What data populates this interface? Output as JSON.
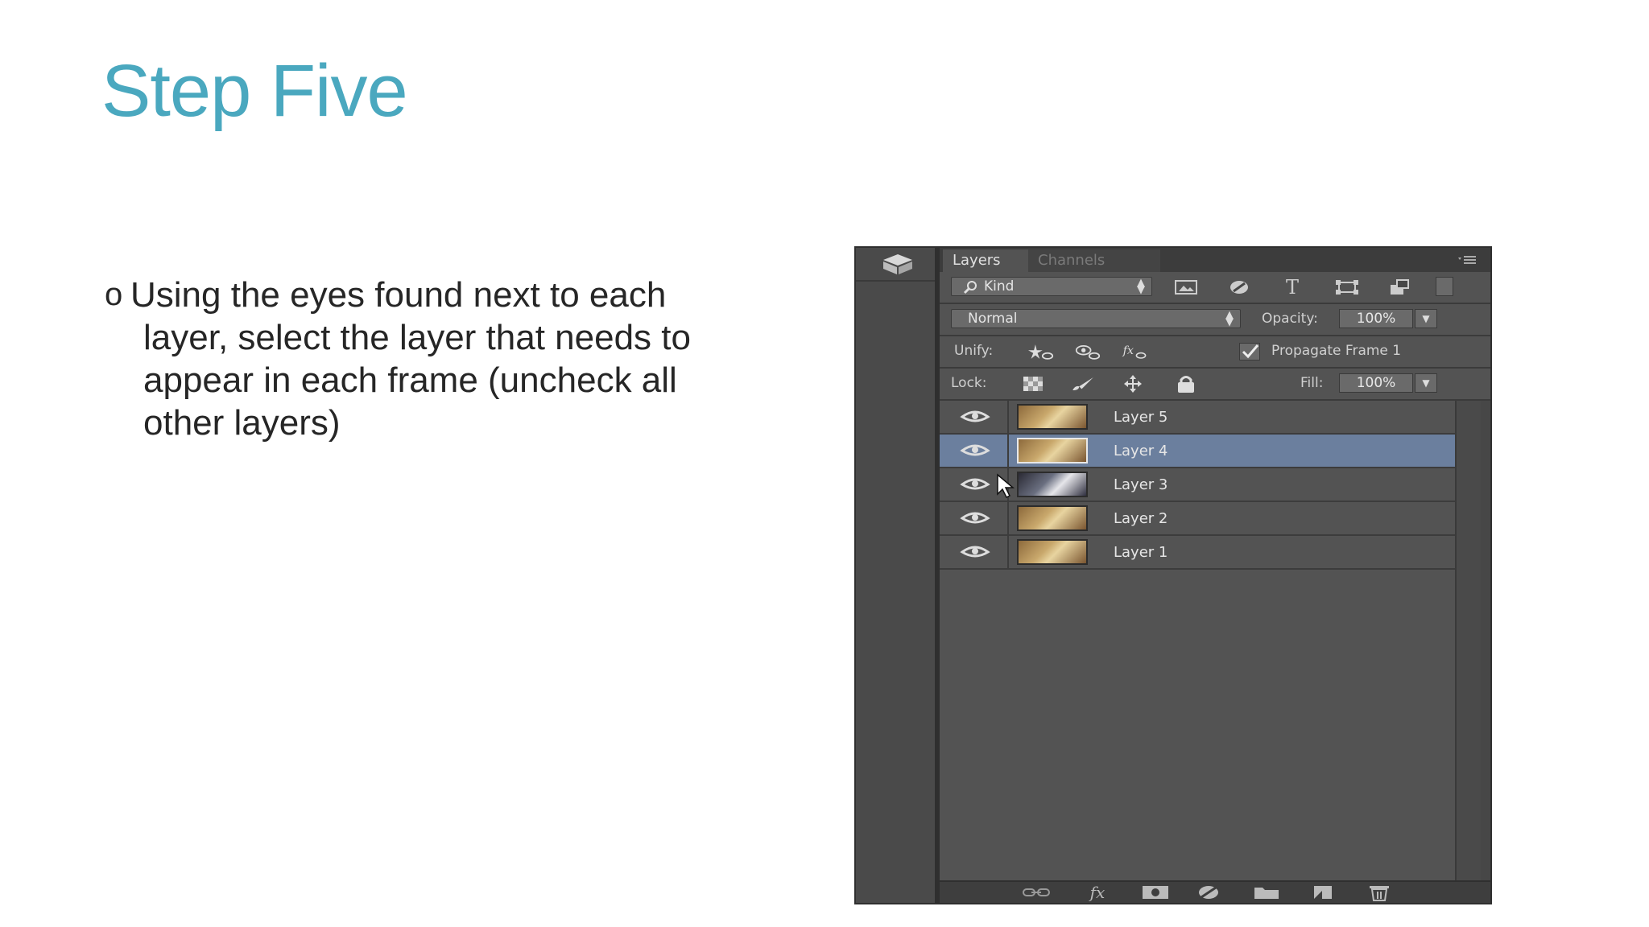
{
  "slide": {
    "title": "Step Five",
    "bullet_mark": "o",
    "bullet_text": "Using the eyes found next to each\nlayer, select the layer that needs to\nappear in each frame (uncheck all\nother layers)"
  },
  "panel": {
    "tabs": [
      "Layers",
      "Channels"
    ],
    "filter_label": "Kind",
    "blend_mode": "Normal",
    "opacity_label": "Opacity:",
    "opacity_value": "100%",
    "unify_label": "Unify:",
    "propagate_label": "Propagate Frame 1",
    "propagate_checked": true,
    "lock_label": "Lock:",
    "fill_label": "Fill:",
    "fill_value": "100%",
    "layers": [
      {
        "name": "Layer 5",
        "visible": true,
        "selected": false
      },
      {
        "name": "Layer 4",
        "visible": true,
        "selected": true
      },
      {
        "name": "Layer 3",
        "visible": true,
        "selected": false
      },
      {
        "name": "Layer 2",
        "visible": true,
        "selected": false
      },
      {
        "name": "Layer 1",
        "visible": true,
        "selected": false
      }
    ],
    "bottom_icons": [
      "link-icon",
      "fx-icon",
      "mask-icon",
      "adjustment-icon",
      "folder-icon",
      "new-layer-icon",
      "trash-icon"
    ],
    "colors": {
      "selection": "#6b7f9e",
      "title": "#4aa8bf"
    }
  }
}
